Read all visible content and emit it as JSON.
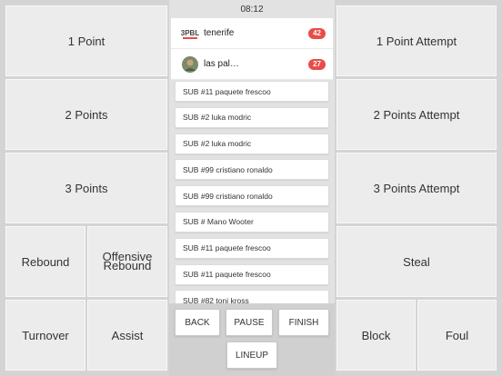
{
  "left_grid": {
    "one_point": "1 Point",
    "two_points": "2 Points",
    "three_points": "3 Points",
    "rebound": "Rebound",
    "offensive_rebound_line1": "Offensive",
    "offensive_rebound_line2": "Rebound",
    "turnover": "Turnover",
    "assist": "Assist"
  },
  "right_grid": {
    "one_point_attempt": "1 Point Attempt",
    "two_points_attempt": "2 Points Attempt",
    "three_points_attempt": "3 Points Attempt",
    "steal": "Steal",
    "block": "Block",
    "foul": "Foul"
  },
  "clock": "08:12",
  "teams": [
    {
      "name": "tenerife",
      "score": "42",
      "logo_text": "3PBL"
    },
    {
      "name": "las pal…",
      "score": "27"
    }
  ],
  "log": [
    "SUB #11 paquete frescoo",
    "SUB #2 luka modric",
    "SUB #2 luka modric",
    "SUB #99 cristiano ronaldo",
    "SUB #99 cristiano ronaldo",
    "SUB # Mano Wooter",
    "SUB #11 paquete frescoo",
    "SUB #11 paquete frescoo",
    "SUB #82 toni kross"
  ],
  "controls": {
    "back": "BACK",
    "pause": "PAUSE",
    "finish": "FINISH",
    "lineup": "LINEUP"
  },
  "colors": {
    "badge": "#e94d47",
    "tile": "#ececec"
  }
}
